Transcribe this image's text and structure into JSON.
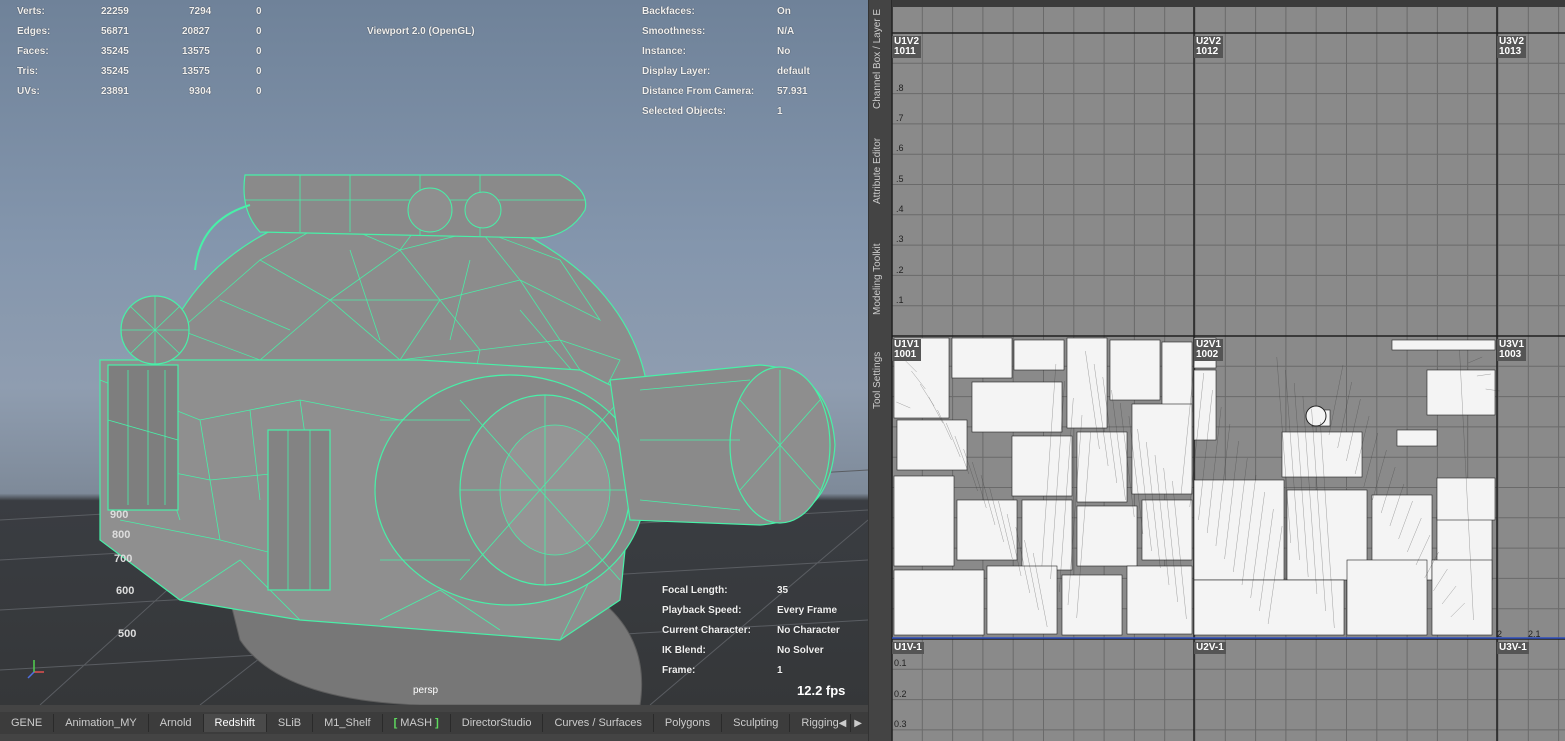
{
  "hud_left": {
    "rows": [
      {
        "label": "Verts:",
        "a": "22259",
        "b": "7294",
        "c": "0"
      },
      {
        "label": "Edges:",
        "a": "56871",
        "b": "20827",
        "c": "0"
      },
      {
        "label": "Faces:",
        "a": "35245",
        "b": "13575",
        "c": "0"
      },
      {
        "label": "Tris:",
        "a": "35245",
        "b": "13575",
        "c": "0"
      },
      {
        "label": "UVs:",
        "a": "23891",
        "b": "9304",
        "c": "0"
      }
    ]
  },
  "renderer": "Viewport 2.0 (OpenGL)",
  "hud_right": {
    "rows": [
      {
        "label": "Backfaces:",
        "value": "On"
      },
      {
        "label": "Smoothness:",
        "value": "N/A"
      },
      {
        "label": "Instance:",
        "value": "No"
      },
      {
        "label": "Display Layer:",
        "value": "default"
      },
      {
        "label": "Distance From Camera:",
        "value": "57.931"
      },
      {
        "label": "Selected Objects:",
        "value": "1"
      }
    ]
  },
  "hud_bottom": {
    "rows": [
      {
        "label": "Focal Length:",
        "value": "35"
      },
      {
        "label": "Playback Speed:",
        "value": "Every Frame"
      },
      {
        "label": "Current Character:",
        "value": "No Character"
      },
      {
        "label": "IK Blend:",
        "value": "No Solver"
      },
      {
        "label": "Frame:",
        "value": "1"
      }
    ]
  },
  "fps": "12.2 fps",
  "camera": "persp",
  "grid_numbers": [
    "900",
    "800",
    "700",
    "600",
    "500"
  ],
  "shelf_tabs": [
    {
      "label": "GENE",
      "active": false
    },
    {
      "label": "Animation_MY",
      "active": false
    },
    {
      "label": "Arnold",
      "active": false
    },
    {
      "label": "Redshift",
      "active": true
    },
    {
      "label": "SLiB",
      "active": false
    },
    {
      "label": "M1_Shelf",
      "active": false
    },
    {
      "label": "MASH",
      "active": false,
      "bracket": true
    },
    {
      "label": "DirectorStudio",
      "active": false
    },
    {
      "label": "Curves / Surfaces",
      "active": false
    },
    {
      "label": "Polygons",
      "active": false
    },
    {
      "label": "Sculpting",
      "active": false
    },
    {
      "label": "Rigging",
      "active": false
    }
  ],
  "side_tabs": [
    "Channel Box / Layer E",
    "Attribute Editor",
    "Modeling Toolkit",
    "Tool Settings"
  ],
  "uv_tiles": {
    "top": [
      {
        "l1": "U1V2",
        "l2": "1011"
      },
      {
        "l1": "U2V2",
        "l2": "1012"
      },
      {
        "l1": "U3V2",
        "l2": "1013"
      }
    ],
    "mid": [
      {
        "l1": "U1V1",
        "l2": "1001"
      },
      {
        "l1": "U2V1",
        "l2": "1002"
      },
      {
        "l1": "U3V1",
        "l2": "1003"
      }
    ],
    "bottom": [
      "U1V-1",
      "U2V-1",
      "U3V-1"
    ]
  },
  "uv_v_ticks": [
    ".8",
    ".7",
    ".6",
    ".5",
    ".4",
    ".3",
    ".2",
    ".1"
  ],
  "uv_bottom_ticks": [
    "0.1",
    "0.2",
    "0.3"
  ],
  "uv_u_ticks": [
    "2",
    "2.1"
  ],
  "colors": {
    "wire": "#48f0a8",
    "mesh": "#8c8c8c",
    "uv_bg": "#8a8a8a",
    "uv_line": "#1f1f1f",
    "shell": "#ffffff"
  }
}
